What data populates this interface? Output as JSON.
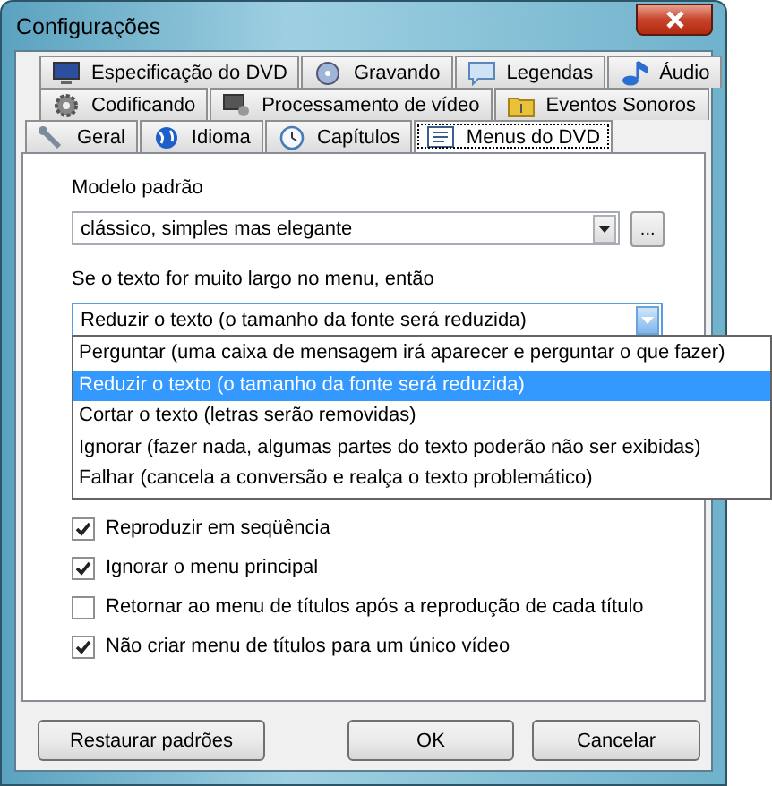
{
  "window": {
    "title": "Configurações"
  },
  "tab_rows": [
    [
      {
        "label": "Especificação do DVD",
        "selected": false
      },
      {
        "label": "Gravando",
        "selected": false
      },
      {
        "label": "Legendas",
        "selected": false
      },
      {
        "label": "Áudio",
        "selected": false
      }
    ],
    [
      {
        "label": "Codificando",
        "selected": false
      },
      {
        "label": "Processamento de vídeo",
        "selected": false
      },
      {
        "label": "Eventos Sonoros",
        "selected": false
      }
    ],
    [
      {
        "label": "Geral",
        "selected": false
      },
      {
        "label": "Idioma",
        "selected": false
      },
      {
        "label": "Capítulos",
        "selected": false
      },
      {
        "label": "Menus do DVD",
        "selected": true
      }
    ]
  ],
  "template": {
    "label": "Modelo padrão",
    "value": "clássico, simples mas elegante",
    "browse_button": "..."
  },
  "overflow": {
    "label": "Se o texto for muito largo no menu, então",
    "value": "Reduzir o texto (o tamanho da fonte será reduzida)",
    "expanded": true,
    "options": [
      {
        "label": "Perguntar (uma caixa de mensagem irá aparecer e perguntar o que fazer)",
        "selected": false
      },
      {
        "label": "Reduzir o texto (o tamanho da fonte será reduzida)",
        "selected": true
      },
      {
        "label": "Cortar o texto (letras serão removidas)",
        "selected": false
      },
      {
        "label": "Ignorar (fazer nada, algumas partes do texto poderão não ser exibidas)",
        "selected": false
      },
      {
        "label": "Falhar (cancela a conversão e realça o texto problemático)",
        "selected": false
      }
    ]
  },
  "checkboxes": [
    {
      "label": "Reproduzir em seqüência",
      "checked": true
    },
    {
      "label": "Ignorar o menu principal",
      "checked": true
    },
    {
      "label": "Retornar ao menu de títulos após a reprodução de cada título",
      "checked": false
    },
    {
      "label": "Não criar menu de títulos para um único vídeo",
      "checked": true
    }
  ],
  "buttons": [
    {
      "label": "Restaurar padrões"
    },
    {
      "label": "OK"
    },
    {
      "label": "Cancelar"
    }
  ]
}
